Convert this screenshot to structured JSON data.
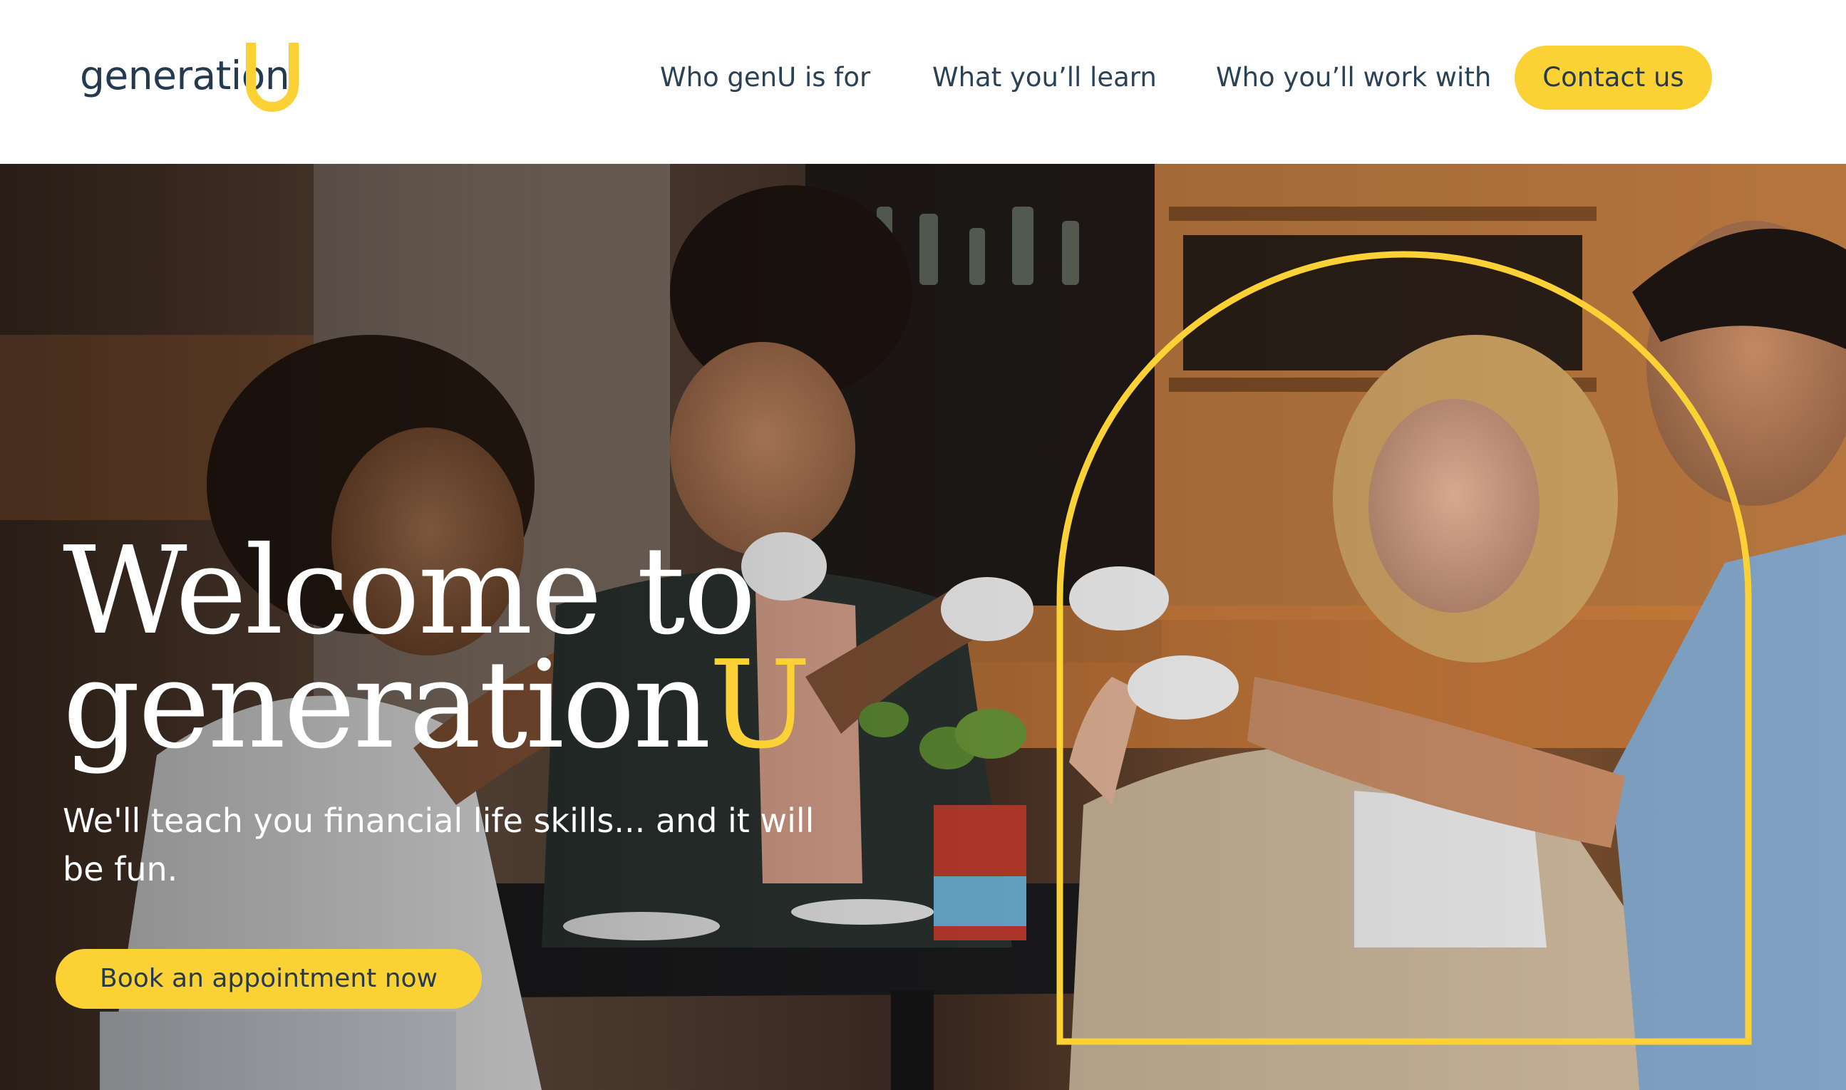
{
  "logo": {
    "word": "generation",
    "letter": "U",
    "accent_color": "#fbd136",
    "text_color": "#243b4f"
  },
  "nav": {
    "items": [
      {
        "label": "Who genU is for"
      },
      {
        "label": "What you’ll learn"
      },
      {
        "label": "Who you’ll work with"
      }
    ],
    "contact_label": "Contact us"
  },
  "hero": {
    "title_line1": "Welcome to",
    "title_line2_word": "generation",
    "title_line2_letter": "U",
    "subtitle": "We'll teach you financial life skills... and it will be fun.",
    "cta_label": "Book an appointment now"
  },
  "colors": {
    "accent": "#fbd136",
    "navy": "#243b4f",
    "white": "#ffffff"
  }
}
